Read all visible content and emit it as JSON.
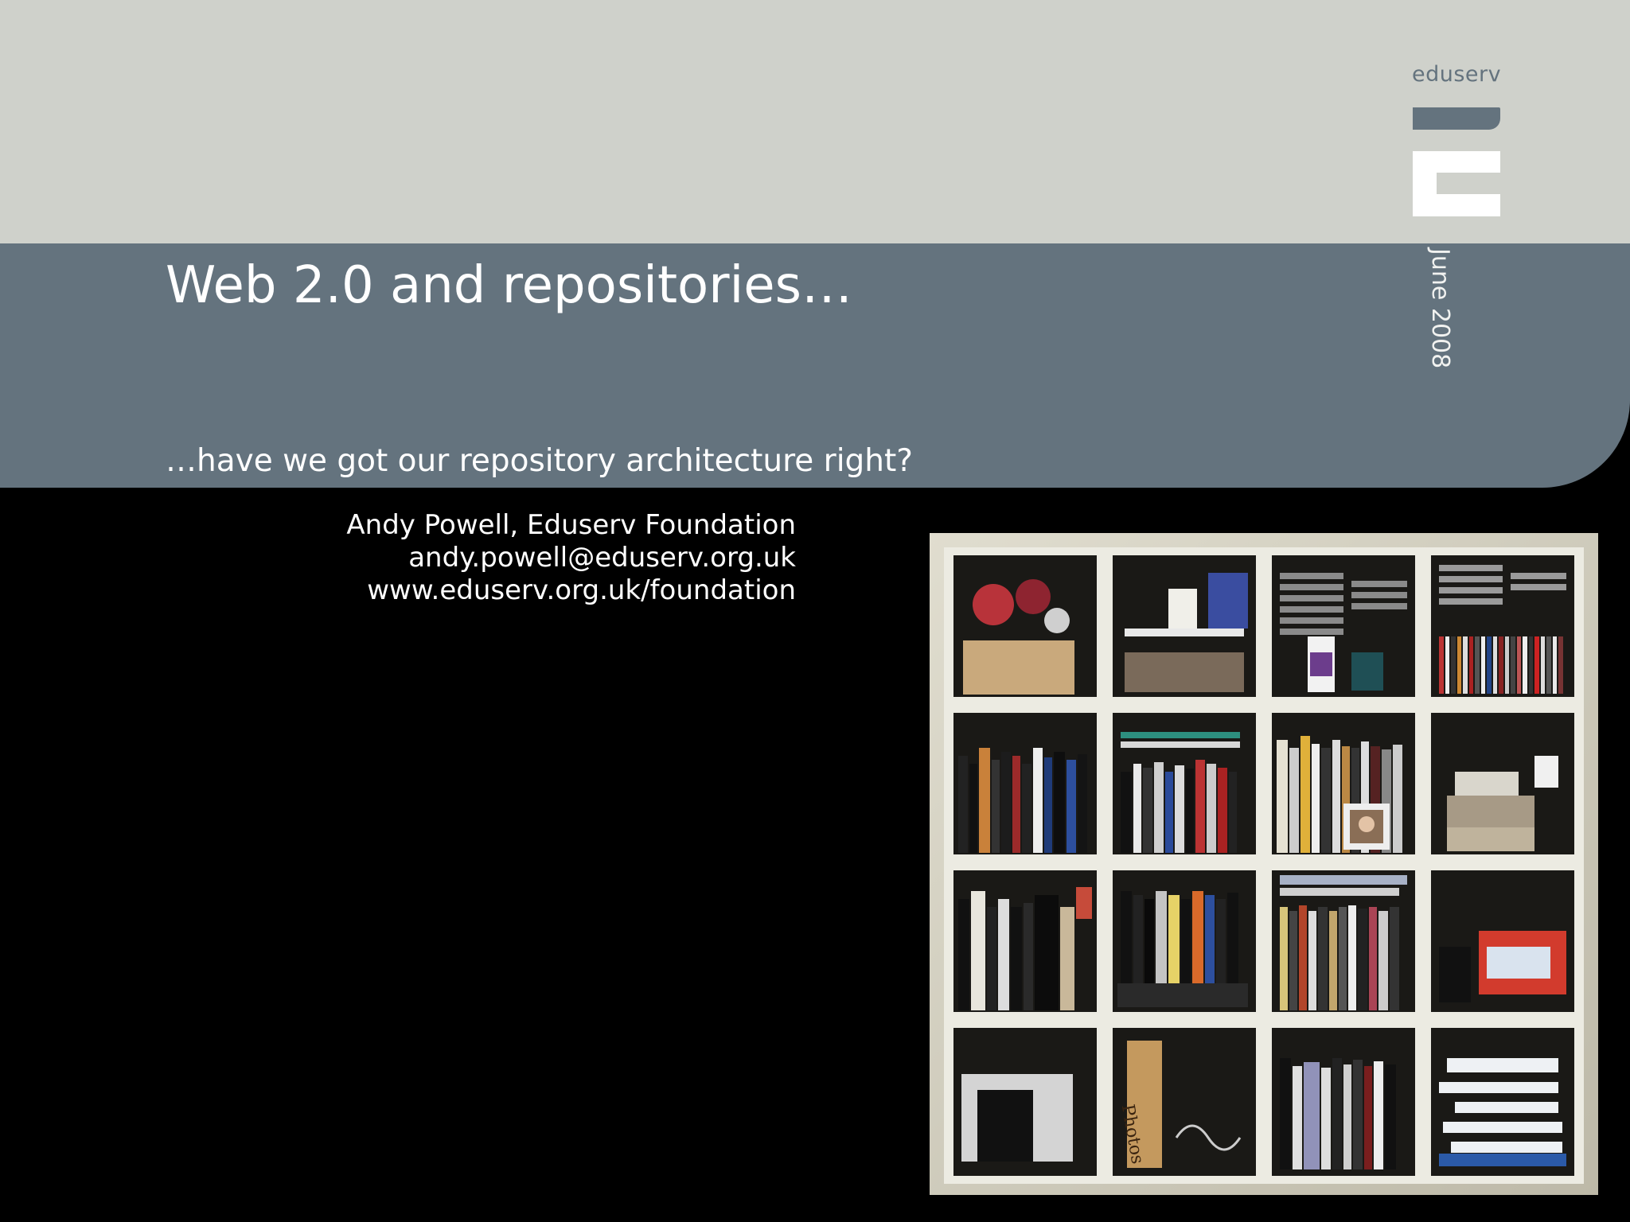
{
  "slide": {
    "title": "Web 2.0 and repositories…",
    "subtitle": "…have we got our repository architecture right?",
    "date": "June 2008",
    "logo_text": "eduserv",
    "author": {
      "name_line": "Andy Powell, Eduserv Foundation",
      "email": "andy.powell@eduserv.org.uk",
      "url": "www.eduserv.org.uk/foundation"
    },
    "colors": {
      "top_band": "#cfd1cb",
      "slate_band": "#64737e",
      "background": "#000000"
    }
  },
  "photo": {
    "subject": "bookshelf-photo",
    "label_on_box": "Photos"
  }
}
